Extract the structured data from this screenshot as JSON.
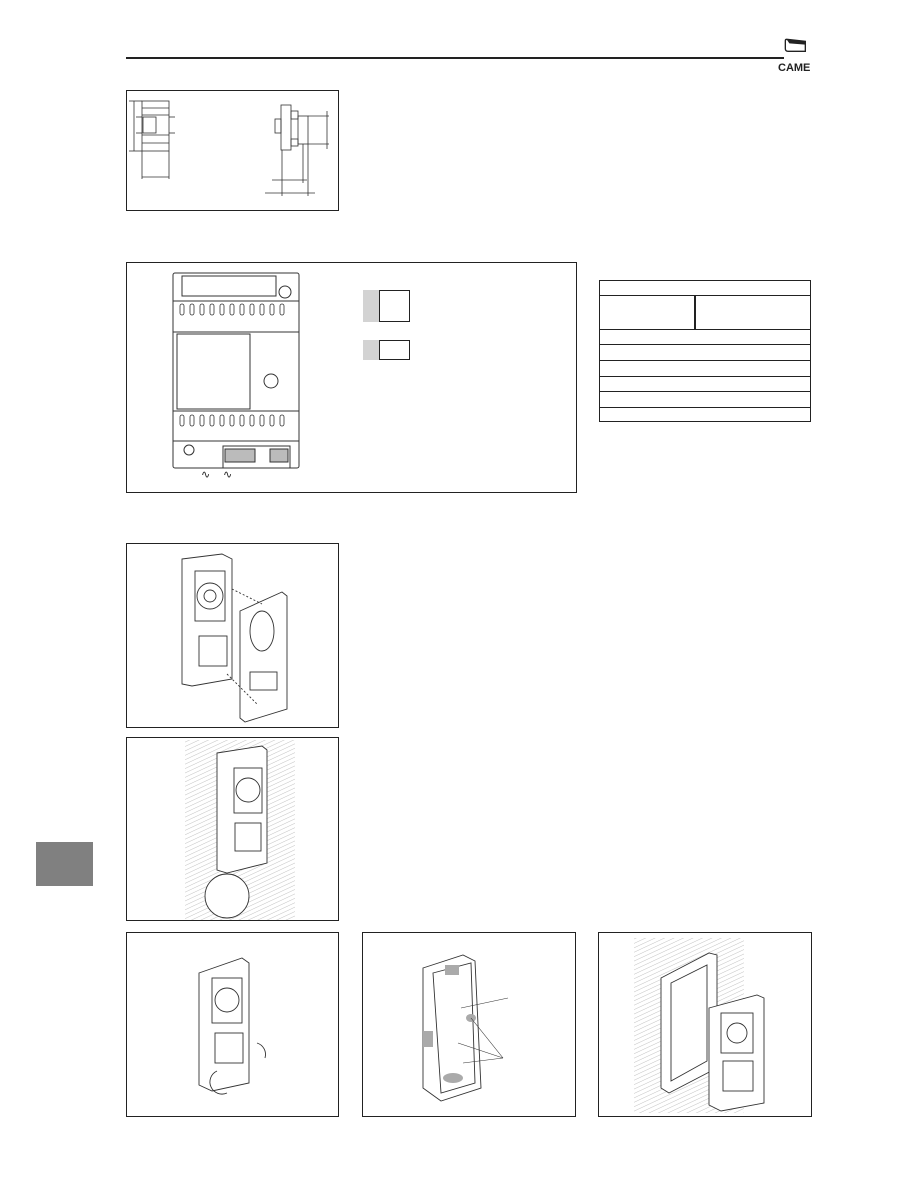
{
  "header": {
    "brand": "CAME",
    "logo_icon": "came-logo-icon"
  },
  "figures": [
    {
      "id": "dimensions-drawing",
      "description": "Power supply front and side dimension drawing"
    },
    {
      "id": "power-supply-terminals",
      "description": "Power supply front view with terminal blocks"
    },
    {
      "id": "panel-front-cover",
      "description": "Entry panel with front cover removed"
    },
    {
      "id": "surface-wall-mount",
      "description": "Entry panel fixed to wall with screws"
    },
    {
      "id": "terminal-cover-open",
      "description": "Opening terminal covers"
    },
    {
      "id": "flush-box-knockouts",
      "description": "Flush mount box with knockouts"
    },
    {
      "id": "flush-frame-mount",
      "description": "Panel mounted in flush frame"
    }
  ],
  "terminals": {
    "ac_input_symbol_1": "∿",
    "ac_input_symbol_2": "∿"
  },
  "legend": {
    "items": [
      {
        "label": ""
      },
      {
        "label": ""
      }
    ]
  },
  "table": {
    "rows": 8,
    "cells": []
  },
  "side_tab": {
    "color": "#808080"
  }
}
